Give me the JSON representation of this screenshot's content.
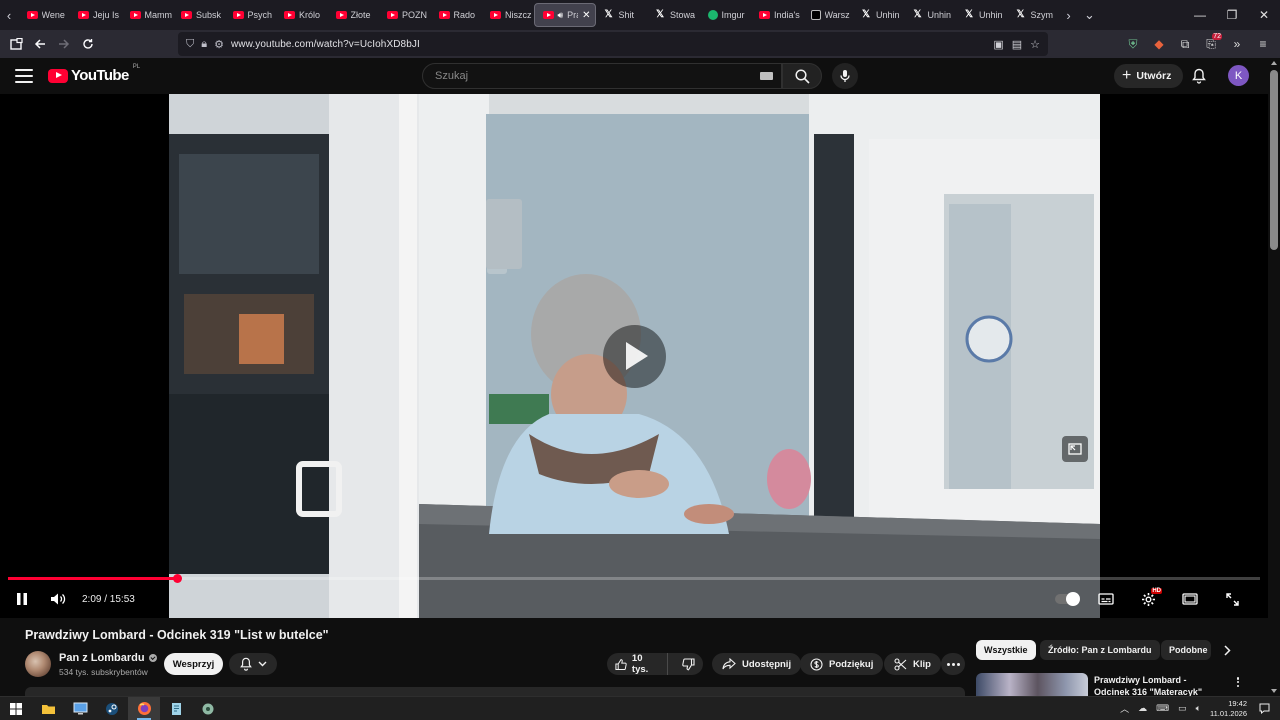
{
  "browser": {
    "tabs": [
      {
        "title": "Wene",
        "icon": "youtube-icon"
      },
      {
        "title": "Jeju Is",
        "icon": "youtube-icon"
      },
      {
        "title": "Mamm",
        "icon": "youtube-icon"
      },
      {
        "title": "Subsk",
        "icon": "youtube-icon"
      },
      {
        "title": "Psych",
        "icon": "youtube-icon"
      },
      {
        "title": "Królo",
        "icon": "youtube-icon"
      },
      {
        "title": "Złote",
        "icon": "youtube-icon"
      },
      {
        "title": "POZN",
        "icon": "youtube-icon"
      },
      {
        "title": "Rado",
        "icon": "youtube-icon"
      },
      {
        "title": "Niszcz",
        "icon": "youtube-icon"
      },
      {
        "title": "Pra",
        "icon": "youtube-icon",
        "active": true
      },
      {
        "title": "Shit",
        "icon": "x-icon"
      },
      {
        "title": "Stowa",
        "icon": "x-icon"
      },
      {
        "title": "Imgur",
        "icon": "imgur-icon"
      },
      {
        "title": "India's",
        "icon": "youtube-icon"
      },
      {
        "title": "Warsz",
        "icon": "tiktok-icon"
      },
      {
        "title": "Unhin",
        "icon": "x-icon"
      },
      {
        "title": "Unhin",
        "icon": "x-icon"
      },
      {
        "title": "Unhin",
        "icon": "x-icon"
      },
      {
        "title": "Szym",
        "icon": "x-icon"
      }
    ],
    "url": "www.youtube.com/watch?v=UcIohXD8bJI",
    "notification_badge": "72"
  },
  "youtube": {
    "logo_text": "YouTube",
    "country_code": "PL",
    "search_placeholder": "Szukaj",
    "create_label": "Utwórz",
    "avatar_letter": "K"
  },
  "player": {
    "current_time": "2:09",
    "duration": "15:53",
    "time_display": "2:09 / 15:53",
    "progress_fraction": 0.135,
    "settings_badge": "HD"
  },
  "video": {
    "title": "Prawdziwy Lombard - Odcinek 319 \"List w butelce\"",
    "channel_name": "Pan z Lombardu",
    "subscribers": "534 tys. subskrybentów",
    "support_label": "Wesprzyj",
    "likes": "10 tys.",
    "share_label": "Udostępnij",
    "thanks_label": "Podziękuj",
    "clip_label": "Klip"
  },
  "sidebar": {
    "chips": [
      "Wszystkie",
      "Źródło: Pan z Lombardu",
      "Podobne"
    ],
    "recommended": [
      {
        "title": "Prawdziwy Lombard - Odcinek 316 \"Materacyk\""
      }
    ]
  },
  "taskbar": {
    "time": "19:42",
    "date": "11.01.2026"
  },
  "colors": {
    "youtube_red": "#ff0033",
    "background": "#0f0f0f",
    "browser_tabstrip": "#1c1b22",
    "browser_toolbar": "#2b2a33",
    "avatar": "#7e57c2"
  }
}
